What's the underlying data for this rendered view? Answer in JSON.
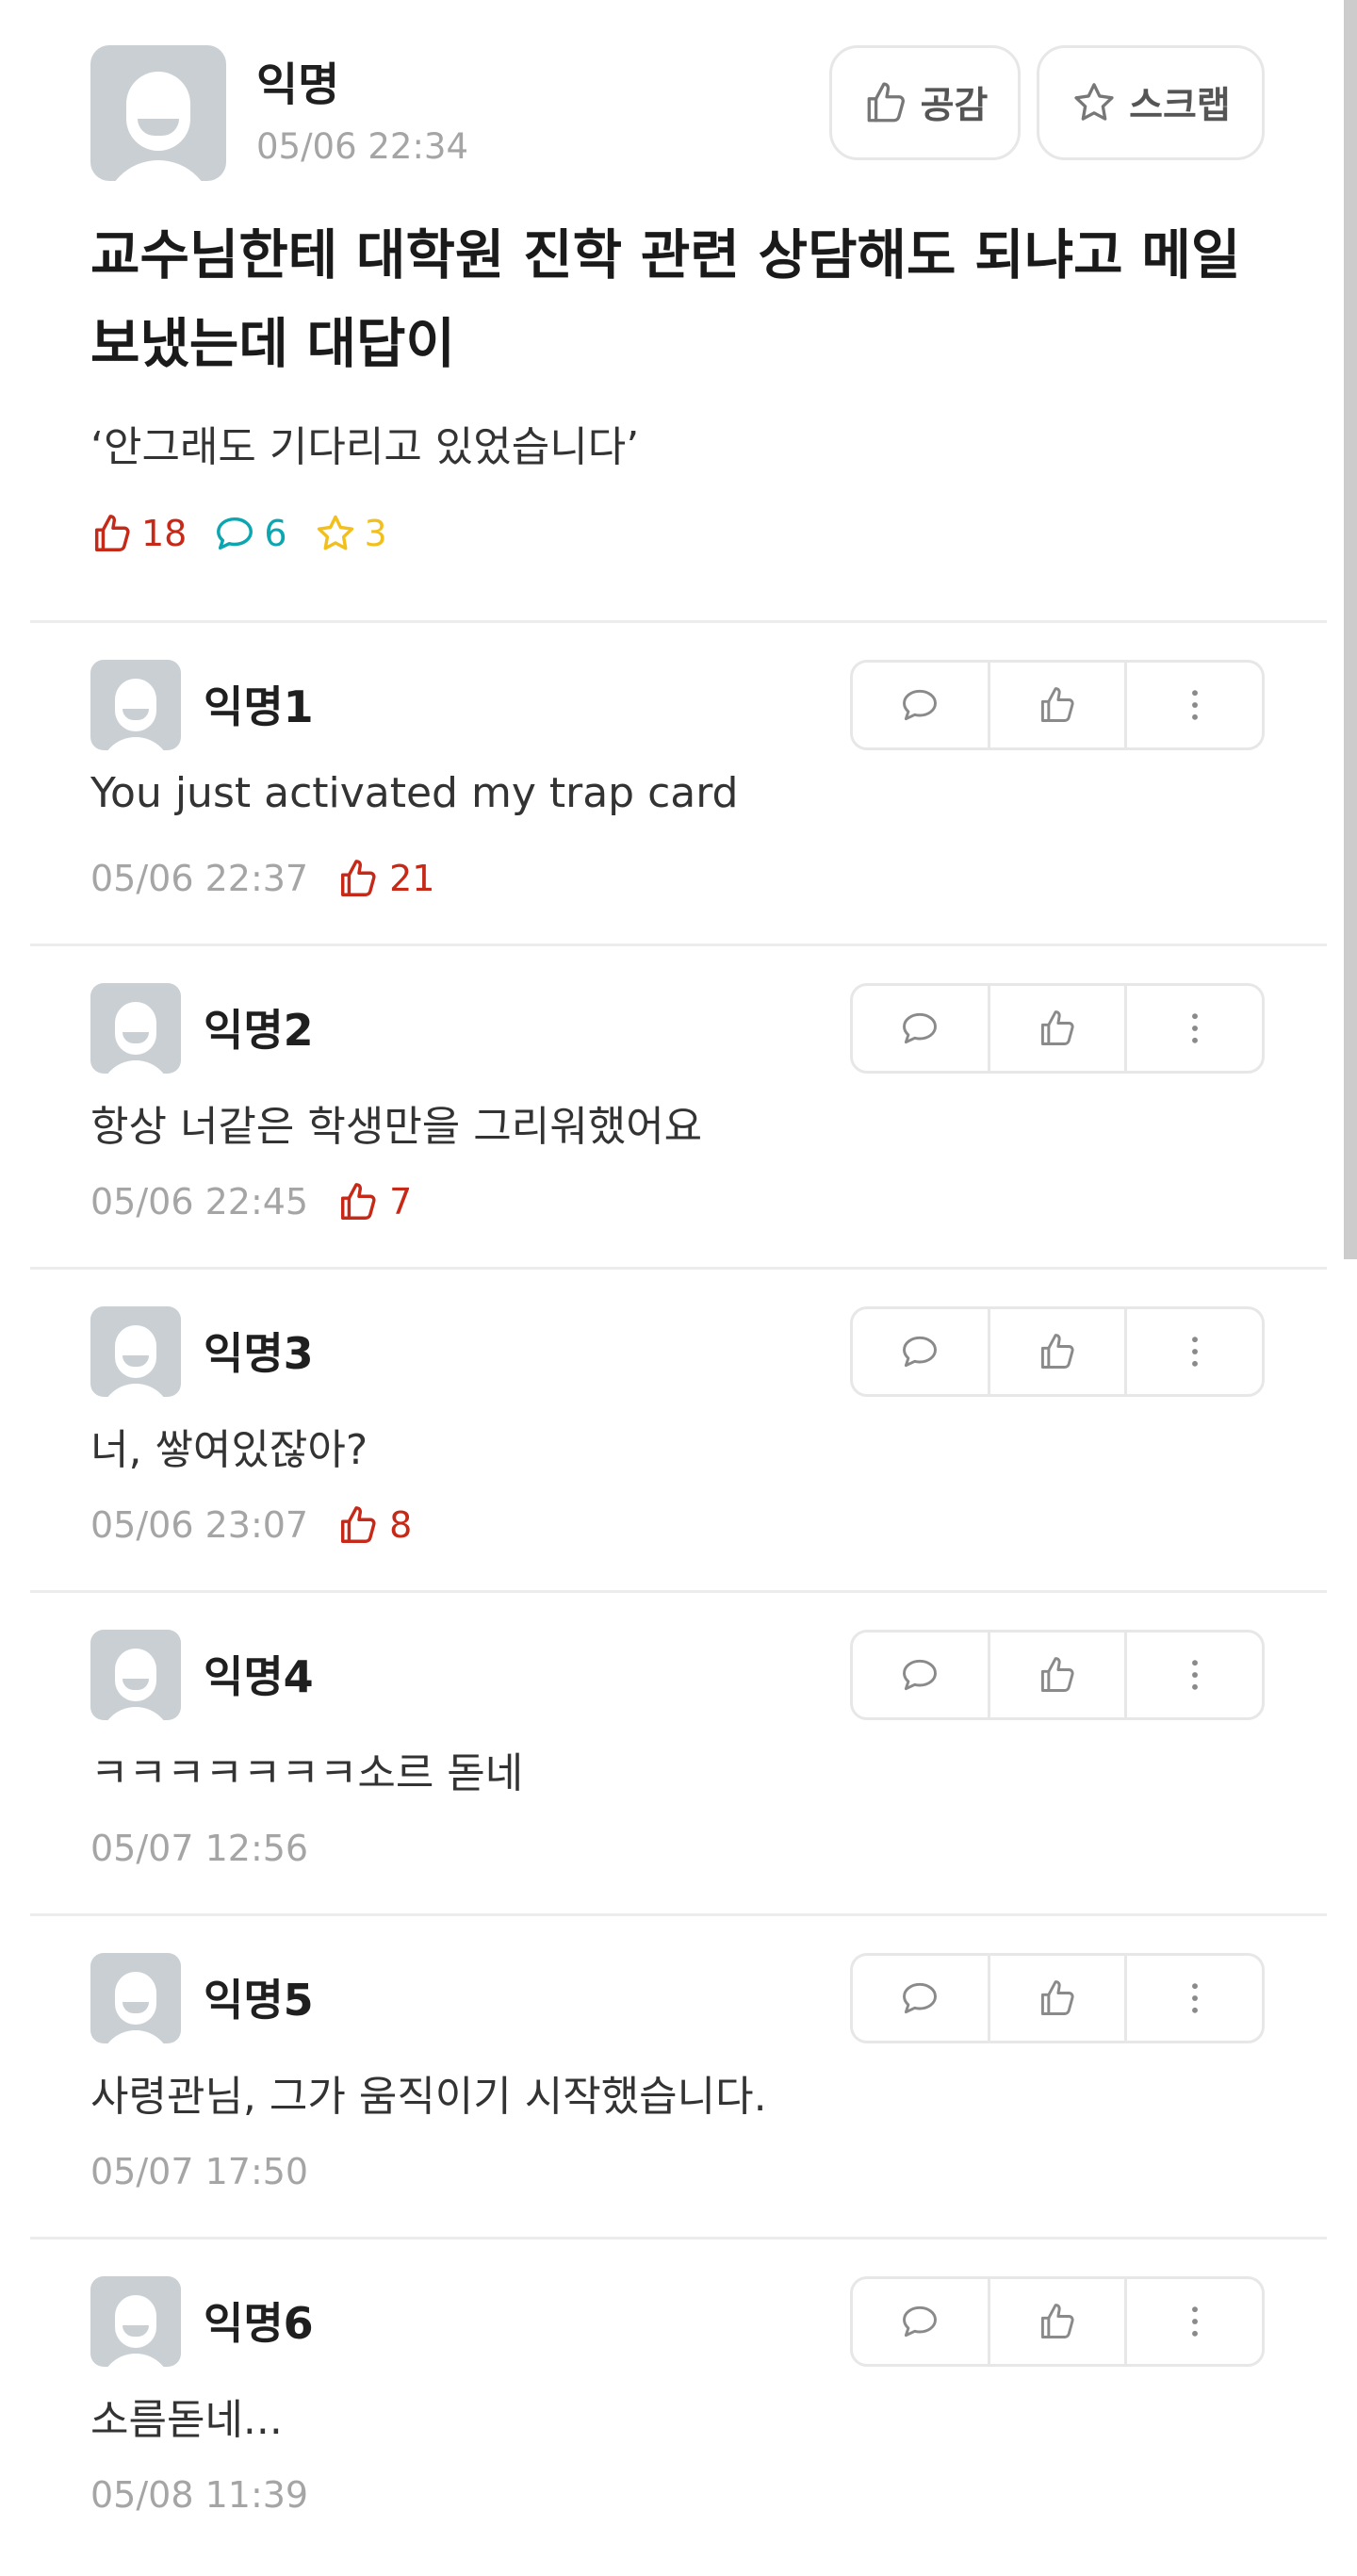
{
  "post": {
    "author": "익명",
    "time": "05/06 22:34",
    "like_label": "공감",
    "scrap_label": "스크랩",
    "title": "교수님한테 대학원 진학 관련 상담해도 되냐고 메일 보냈는데 대답이",
    "body": "‘안그래도 기다리고 있었습니다’",
    "likes": "18",
    "comments": "6",
    "scraps": "3"
  },
  "comments": [
    {
      "author": "익명1",
      "text": "You just activated my trap card",
      "time": "05/06 22:37",
      "likes": "21"
    },
    {
      "author": "익명2",
      "text": "항상 너같은 학생만을 그리워했어요",
      "time": "05/06 22:45",
      "likes": "7"
    },
    {
      "author": "익명3",
      "text": "너, 쌓여있잖아?",
      "time": "05/06 23:07",
      "likes": "8"
    },
    {
      "author": "익명4",
      "text": "ㅋㅋㅋㅋㅋㅋㅋ소르 돋네",
      "time": "05/07 12:56",
      "likes": null
    },
    {
      "author": "익명5",
      "text": "사령관님, 그가 움직이기 시작했습니다.",
      "time": "05/07 17:50",
      "likes": null
    },
    {
      "author": "익명6",
      "text": "소름돋네...",
      "time": "05/08 11:39",
      "likes": null
    }
  ],
  "colors": {
    "like_red": "#c62917",
    "comment_teal": "#0ca5b0",
    "scrap_yellow": "#f2c01d",
    "muted_gray": "#a5a5a5"
  },
  "icons": {
    "like": "thumbs-up-icon",
    "comment": "speech-bubble-icon",
    "scrap": "star-icon",
    "more": "more-vertical-icon"
  }
}
